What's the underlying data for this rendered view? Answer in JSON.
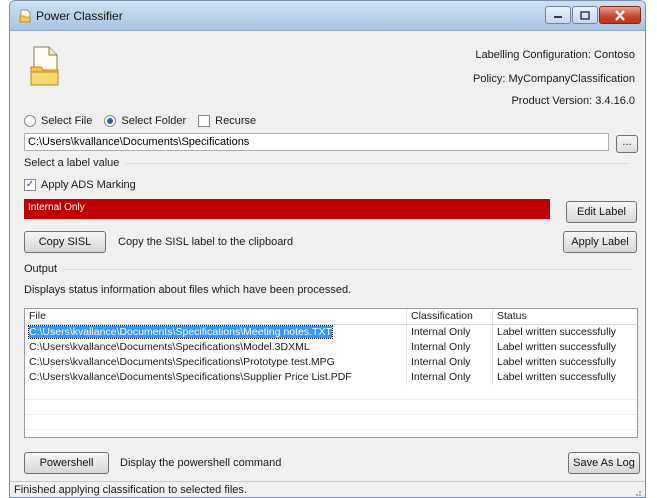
{
  "window": {
    "title": "Power Classifier",
    "icons": {
      "app": "document-folder-icon",
      "main": "document-folder-icon"
    }
  },
  "info": {
    "labelling_configuration": "Labelling Configuration: Contoso",
    "policy": "Policy: MyCompanyClassification",
    "product_version": "Product Version: 3.4.16.0"
  },
  "selection": {
    "select_file_label": "Select File",
    "select_folder_label": "Select Folder",
    "recurse_label": "Recurse",
    "select_folder_selected": true,
    "recurse_checked": false,
    "path_value": "C:\\Users\\kvallance\\Documents\\Specifications",
    "browse_label": "..."
  },
  "label_section": {
    "group_title": "Select a label value",
    "apply_ads_label": "Apply ADS Marking",
    "apply_ads_checked": true,
    "selected_label": "Internal Only",
    "label_color": "#c00000",
    "edit_label_button": "Edit Label",
    "copy_sisl_button": "Copy SISL",
    "copy_sisl_hint": "Copy the SISL label to the clipboard",
    "apply_label_button": "Apply Label"
  },
  "output": {
    "group_title": "Output",
    "description": "Displays status information about files which have been processed.",
    "columns": [
      "File",
      "Classification",
      "Status"
    ],
    "rows": [
      {
        "file": "C:\\Users\\kvallance\\Documents\\Specifications\\Meeting notes.TXT",
        "classification": "Internal Only",
        "status": "Label written successfully",
        "selected": true
      },
      {
        "file": "C:\\Users\\kvallance\\Documents\\Specifications\\Model.3DXML",
        "classification": "Internal Only",
        "status": "Label written successfully",
        "selected": false
      },
      {
        "file": "C:\\Users\\kvallance\\Documents\\Specifications\\Prototype test.MPG",
        "classification": "Internal Only",
        "status": "Label written successfully",
        "selected": false
      },
      {
        "file": "C:\\Users\\kvallance\\Documents\\Specifications\\Supplier Price List.PDF",
        "classification": "Internal Only",
        "status": "Label written successfully",
        "selected": false
      }
    ]
  },
  "footer": {
    "powershell_button": "Powershell",
    "powershell_hint": "Display the powershell command",
    "save_log_button": "Save As Log",
    "status_text": "Finished applying classification to selected files."
  }
}
